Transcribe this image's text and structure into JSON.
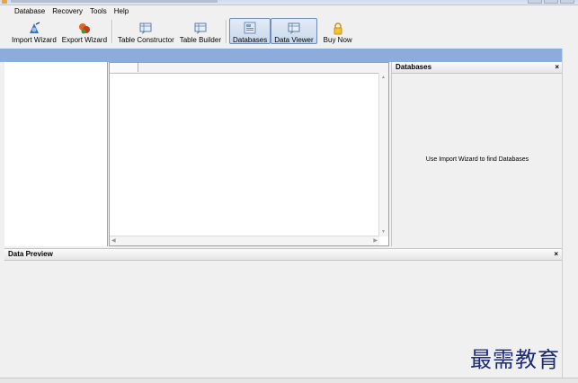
{
  "menu": {
    "items": [
      {
        "label": "Database"
      },
      {
        "label": "Recovery"
      },
      {
        "label": "Tools"
      },
      {
        "label": "Help"
      }
    ]
  },
  "toolbar": {
    "import_wizard": "Import Wizard",
    "export_wizard": "Export Wizard",
    "table_constructor": "Table Constructor",
    "table_builder": "Table Builder",
    "databases": "Databases",
    "data_viewer": "Data Viewer",
    "buy_now": "Buy Now"
  },
  "databases_pane": {
    "title": "Databases",
    "close": "×",
    "message": "Use Import Wizard to find Databases"
  },
  "data_preview": {
    "title": "Data Preview",
    "close": "×"
  },
  "watermark": "最需教育",
  "icons": {
    "import": "import-wizard-icon",
    "export": "export-wizard-icon",
    "table_constructor": "table-constructor-icon",
    "table_builder": "table-builder-icon",
    "databases": "databases-icon",
    "data_viewer": "data-viewer-icon",
    "buy_now": "lock-icon"
  },
  "colors": {
    "accent_strip": "#8cacdc",
    "active_tool_border": "#6f8fb8",
    "watermark": "#1b2a7a"
  }
}
